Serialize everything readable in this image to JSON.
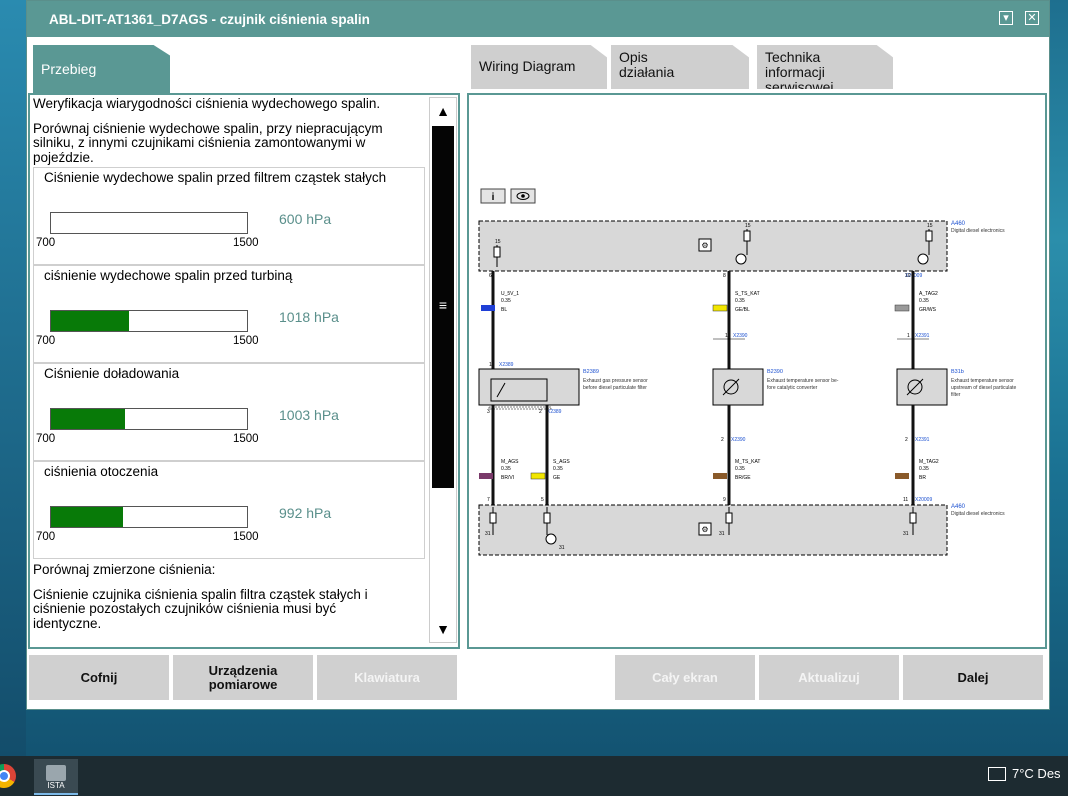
{
  "window": {
    "title": "ABL-DIT-AT1361_D7AGS  -  czujnik ciśnienia spalin"
  },
  "tabs": {
    "left": "Przebieg",
    "right": [
      {
        "label": "Wiring Diagram"
      },
      {
        "label": "Opis działania"
      },
      {
        "label": "Technika informacji serwisowej"
      }
    ]
  },
  "procedure": {
    "intro1": "Weryfikacja wiarygodności ciśnienia wydechowego spalin.",
    "intro2": "Porównaj ciśnienie wydechowe spalin, przy niepracującym silniku, z innymi czujnikami ciśnienia zamontowanymi w pojeździe.",
    "gauges": [
      {
        "title": "Ciśnienie wydechowe spalin przed filtrem cząstek stałych",
        "min": "700",
        "max": "1500",
        "value": "600 hPa",
        "fill_fraction": 0
      },
      {
        "title": "ciśnienie wydechowe spalin przed turbiną",
        "min": "700",
        "max": "1500",
        "value": "1018 hPa",
        "fill_fraction": 0.4
      },
      {
        "title": "Ciśnienie doładowania",
        "min": "700",
        "max": "1500",
        "value": "1003 hPa",
        "fill_fraction": 0.38
      },
      {
        "title": "ciśnienia otoczenia",
        "min": "700",
        "max": "1500",
        "value": "992 hPa",
        "fill_fraction": 0.365
      }
    ],
    "outro1": "Porównaj zmierzone ciśnienia:",
    "outro2": "Ciśnienie czujnika ciśnienia spalin filtra cząstek stałych i ciśnienie pozostałych czujników ciśnienia musi być identyczne."
  },
  "diagram": {
    "buttons": [
      "i",
      "eye"
    ],
    "top_block": {
      "id": "A460",
      "desc": "Digital diesel electronics",
      "connector": "X20009"
    },
    "bottom_block": {
      "id": "A460",
      "desc": "Digital diesel electronics",
      "connector": "X20009"
    },
    "pins_top": [
      "6",
      "8",
      "10"
    ],
    "pins_bottom": [
      "7",
      "5",
      "9",
      "11"
    ],
    "wires": [
      {
        "signal": "U_5V_1",
        "size": "0.35",
        "color": "BL",
        "hex": "#1f3fd6"
      },
      {
        "signal": "S_TS_KAT",
        "size": "0.35",
        "color": "GE/BL",
        "hex": "#f2e600"
      },
      {
        "signal": "A_TAG2",
        "size": "0.35",
        "color": "GR/WS",
        "hex": "#9a9a9a"
      },
      {
        "signal": "M_AGS",
        "size": "0.35",
        "color": "BR/VI",
        "hex": "#7a3a6a"
      },
      {
        "signal": "S_AGS",
        "size": "0.35",
        "color": "GE",
        "hex": "#f2e600"
      },
      {
        "signal": "M_TS_KAT",
        "size": "0.35",
        "color": "BR/GE",
        "hex": "#8a5a2a"
      },
      {
        "signal": "M_TAG2",
        "size": "0.35",
        "color": "BR",
        "hex": "#8a5a2a"
      }
    ],
    "sensors": [
      {
        "id": "B2389",
        "connector": "X2389",
        "desc1": "Exhaust gas pressure sensor",
        "desc2": "before diesel particulate filter"
      },
      {
        "id": "B2390",
        "connector": "X2390",
        "desc1": "Exhaust temperature sensor be-",
        "desc2": "fore catalytic converter"
      },
      {
        "id": "B31b",
        "connector": "X2391",
        "desc1": "Exhaust temperature sensor",
        "desc2": "upstream of diesel particulate",
        "desc3": "filter"
      }
    ],
    "misc": {
      "p15": "15",
      "p31": "31",
      "p1": "1",
      "p2": "2",
      "p3": "3"
    }
  },
  "buttons": {
    "back": "Cofnij",
    "devices": "Urządzenia pomiarowe",
    "keyboard": "Klawiatura",
    "fullscreen": "Cały ekran",
    "refresh": "Aktualizuj",
    "next": "Dalej"
  },
  "taskbar": {
    "app_label": "ISTA",
    "weather": "7°C  Des"
  }
}
